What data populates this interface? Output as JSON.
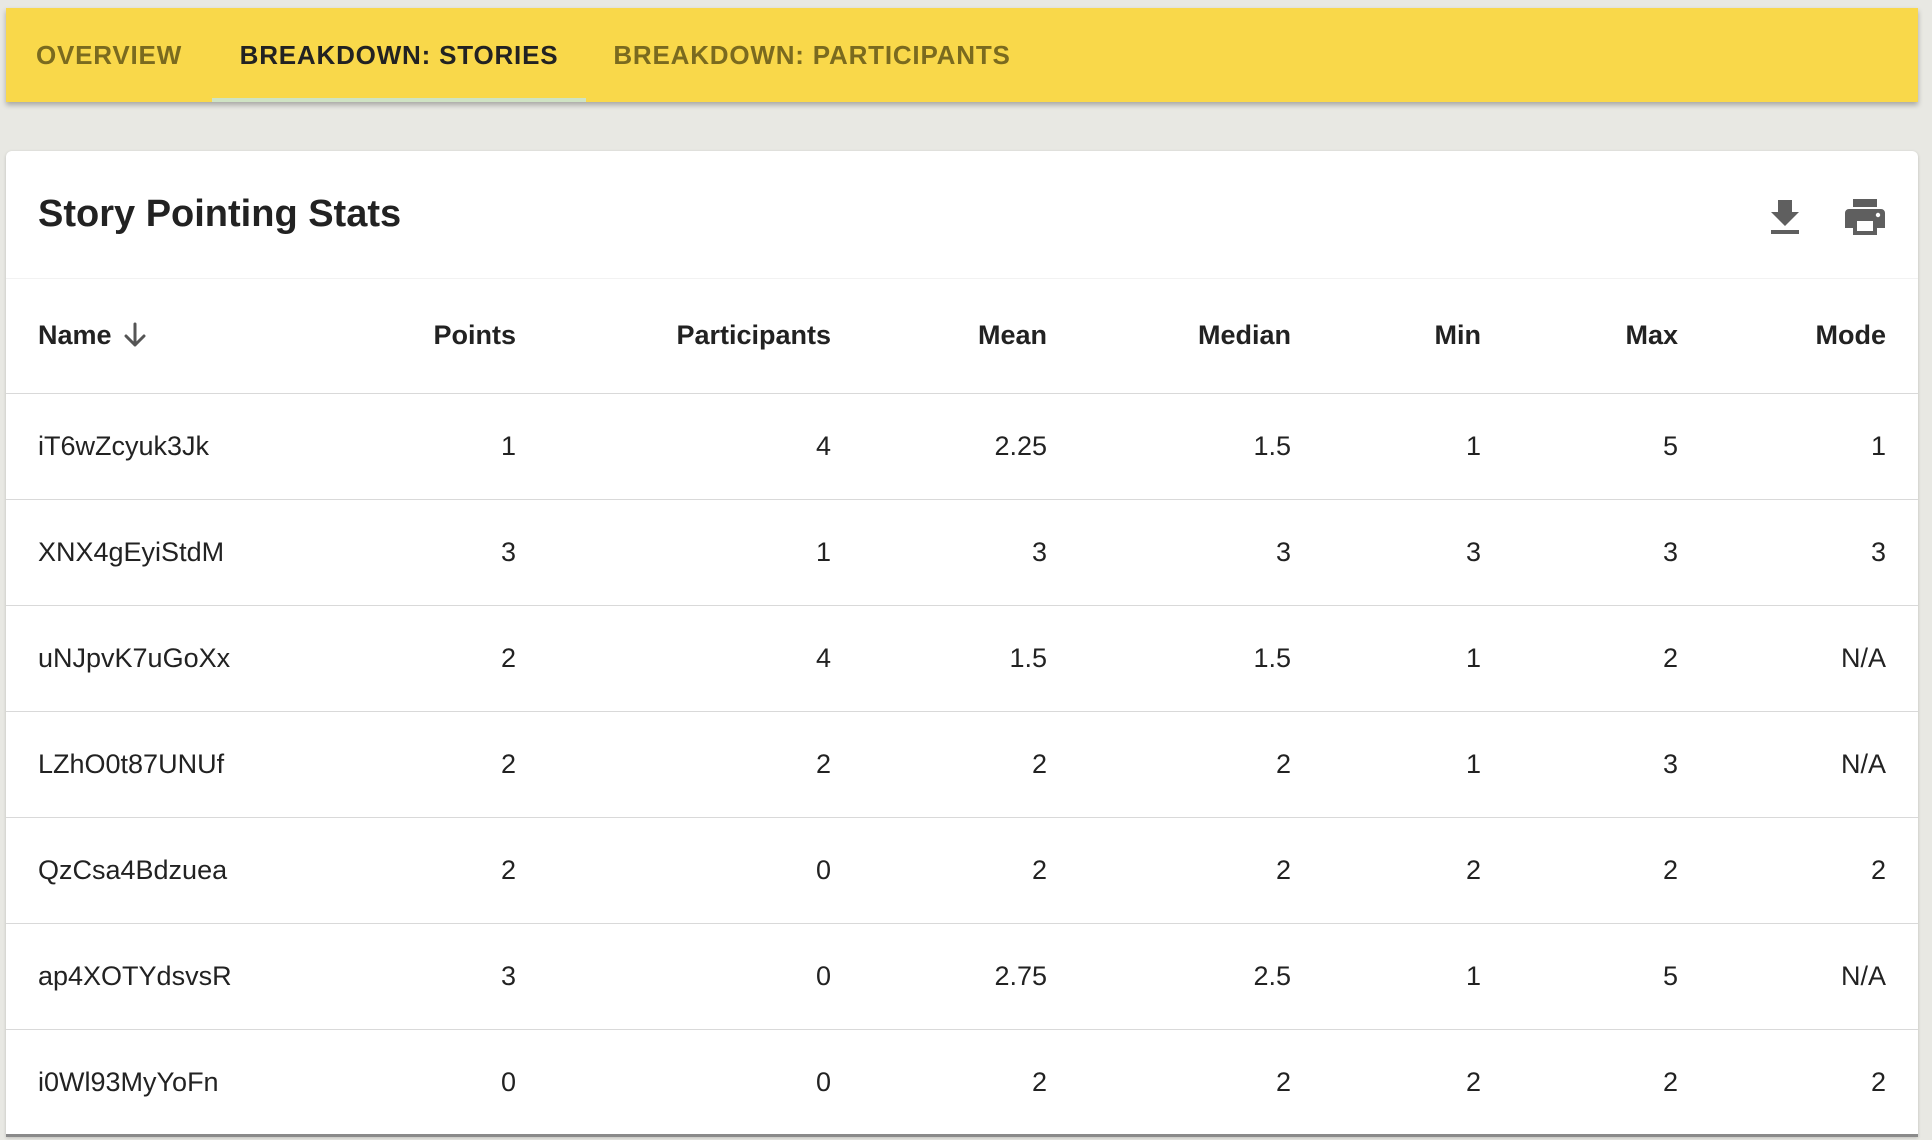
{
  "tabs": [
    {
      "label": "OVERVIEW",
      "active": false
    },
    {
      "label": "BREAKDOWN: STORIES",
      "active": true
    },
    {
      "label": "BREAKDOWN: PARTICIPANTS",
      "active": false
    }
  ],
  "colors": {
    "tab_bar": "#f9d84a",
    "active_tab_indicator": "#cfe3c4",
    "background": "#e8e8e3"
  },
  "card": {
    "title": "Story Pointing Stats",
    "actions": [
      "download-icon",
      "print-icon"
    ]
  },
  "table": {
    "sorted_by": "Name",
    "sort_direction": "descending",
    "columns": [
      "Name",
      "Points",
      "Participants",
      "Mean",
      "Median",
      "Min",
      "Max",
      "Mode"
    ],
    "rows": [
      [
        "iT6wZcyuk3Jk",
        "1",
        "4",
        "2.25",
        "1.5",
        "1",
        "5",
        "1"
      ],
      [
        "XNX4gEyiStdM",
        "3",
        "1",
        "3",
        "3",
        "3",
        "3",
        "3"
      ],
      [
        "uNJpvK7uGoXx",
        "2",
        "4",
        "1.5",
        "1.5",
        "1",
        "2",
        "N/A"
      ],
      [
        "LZhO0t87UNUf",
        "2",
        "2",
        "2",
        "2",
        "1",
        "3",
        "N/A"
      ],
      [
        "QzCsa4Bdzuea",
        "2",
        "0",
        "2",
        "2",
        "2",
        "2",
        "2"
      ],
      [
        "ap4XOTYdsvsR",
        "3",
        "0",
        "2.75",
        "2.5",
        "1",
        "5",
        "N/A"
      ],
      [
        "i0Wl93MyYoFn",
        "0",
        "0",
        "2",
        "2",
        "2",
        "2",
        "2"
      ]
    ]
  }
}
